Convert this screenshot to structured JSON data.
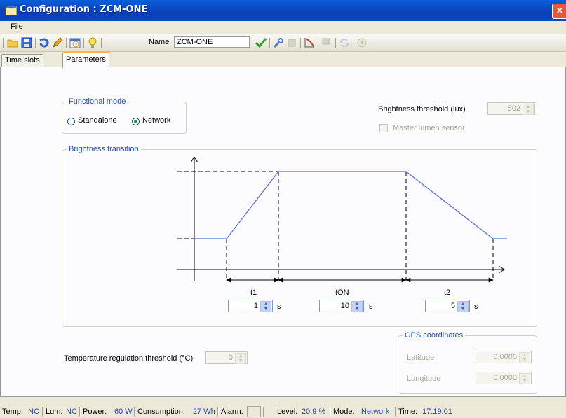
{
  "window": {
    "title": "Configuration : ZCM-ONE"
  },
  "menu": {
    "file": "File"
  },
  "toolbar": {
    "name_label": "Name",
    "name_value": "ZCM-ONE",
    "icons": [
      "open-folder-icon",
      "save-icon",
      "undo-icon",
      "edit-pencil-icon",
      "calendar-clock-icon",
      "lightbulb-icon",
      "checkmark-icon",
      "wrench-icon",
      "stop-icon",
      "curve-chart-icon",
      "flag-icon",
      "refresh-icon",
      "help-circle-icon"
    ]
  },
  "tabs": [
    {
      "label": "Time slots"
    },
    {
      "label": "Parameters"
    }
  ],
  "functional_mode": {
    "legend": "Functional mode",
    "options": [
      {
        "label": "Standalone",
        "selected": false
      },
      {
        "label": "Network",
        "selected": true
      }
    ]
  },
  "brightness_threshold": {
    "label": "Brightness threshold (lux)",
    "value": "502"
  },
  "master_lumen_sensor": {
    "label": "Master lumen sensor",
    "checked": false
  },
  "brightness_transition": {
    "legend": "Brightness transition",
    "t1": {
      "label": "t1",
      "value": "1",
      "unit": "s"
    },
    "ton": {
      "label": "tON",
      "value": "10",
      "unit": "s"
    },
    "t2": {
      "label": "t2",
      "value": "5",
      "unit": "s"
    }
  },
  "temperature": {
    "label": "Temperature regulation threshold (°C)",
    "value": "0"
  },
  "gps": {
    "legend": "GPS coordinates",
    "latitude_label": "Latitude",
    "latitude_value": "0.0000",
    "longitude_label": "Longitude",
    "longitude_value": "0.0000"
  },
  "status": {
    "temp_label": "Temp:",
    "temp_value": "NC",
    "lum_label": "Lum:",
    "lum_value": "NC",
    "power_label": "Power:",
    "power_value": "60 W",
    "consumption_label": "Consumption:",
    "consumption_value": "27 Wh",
    "alarm_label": "Alarm:",
    "level_label": "Level:",
    "level_value": "20.9 %",
    "mode_label": "Mode:",
    "mode_value": "Network",
    "time_label": "Time:",
    "time_value": "17:19:01"
  },
  "colors": {
    "accent": "#1f4fc6",
    "curve": "#5b6fe0",
    "title_bar": "#0a4fc7"
  }
}
